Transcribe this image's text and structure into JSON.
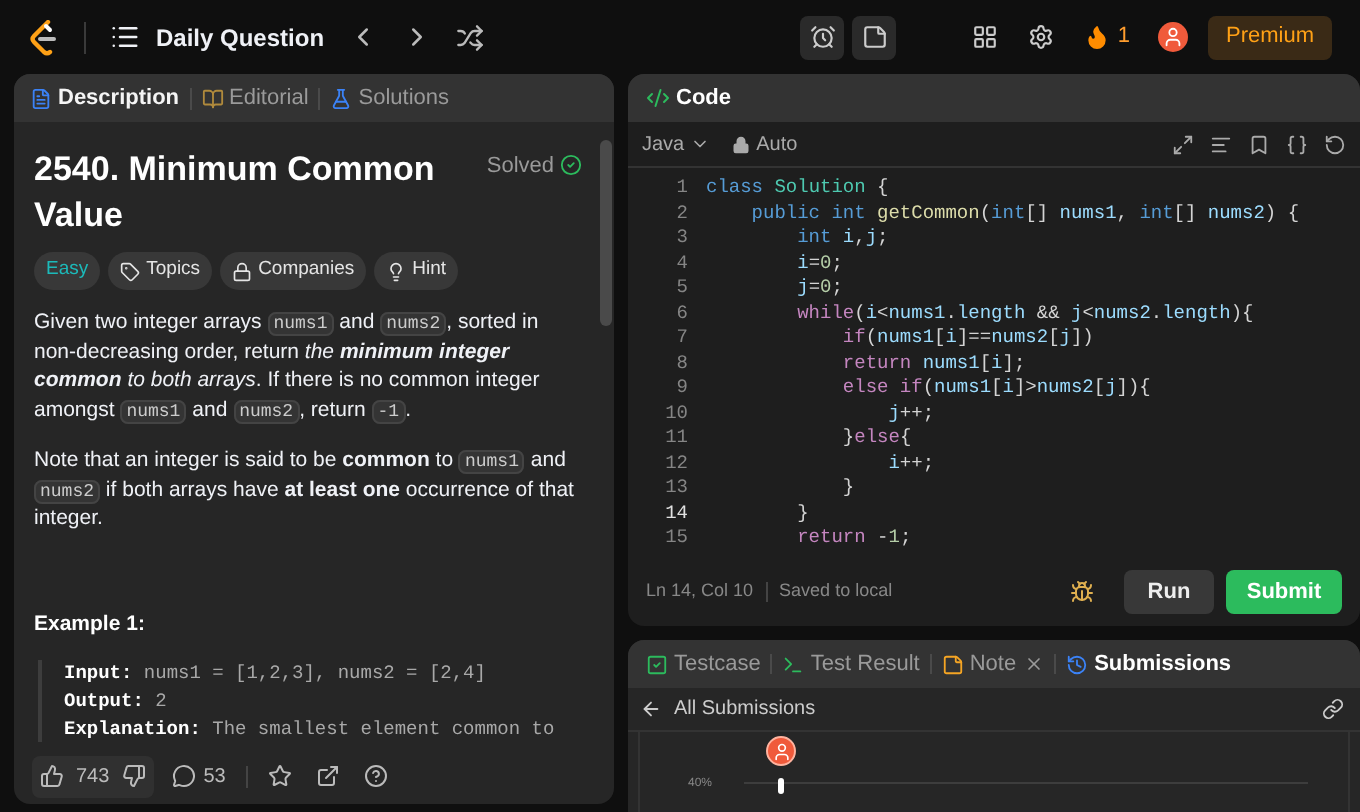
{
  "top_bar": {
    "title": "Daily Question",
    "streak": "1",
    "premium": "Premium"
  },
  "problem_panel": {
    "tabs": [
      {
        "label": "Description",
        "selected": true
      },
      {
        "label": "Editorial",
        "selected": false
      },
      {
        "label": "Solutions",
        "selected": false
      }
    ],
    "title": "2540. Minimum Common Value",
    "status": "Solved",
    "tags": [
      {
        "label": "Easy",
        "kind": "difficulty"
      },
      {
        "label": "Topics",
        "kind": "topics"
      },
      {
        "label": "Companies",
        "kind": "companies"
      },
      {
        "label": "Hint",
        "kind": "hint"
      }
    ],
    "paragraphs": [
      [
        {
          "kind": "text",
          "text": "Given two integer arrays "
        },
        {
          "kind": "code",
          "text": "nums1"
        },
        {
          "kind": "text",
          "text": " and "
        },
        {
          "kind": "code",
          "text": "nums2"
        },
        {
          "kind": "text",
          "text": ", sorted in non-decreasing order, return *the* "
        },
        {
          "kind": "strong_italic",
          "text": "minimum integer common"
        },
        {
          "kind": "text",
          "text": " *to both arrays*. If there is no common integer amongst "
        },
        {
          "kind": "code",
          "text": "nums1"
        },
        {
          "kind": "text",
          "text": " and "
        },
        {
          "kind": "code",
          "text": "nums2"
        },
        {
          "kind": "text",
          "text": ", return "
        },
        {
          "kind": "code",
          "text": "-1"
        },
        {
          "kind": "text",
          "text": "."
        }
      ],
      [
        {
          "kind": "text",
          "text": "Note that an integer is said to be **common** to "
        },
        {
          "kind": "code",
          "text": "nums1"
        },
        {
          "kind": "text",
          "text": " and "
        },
        {
          "kind": "code",
          "text": "nums2"
        },
        {
          "kind": "text",
          "text": " if both arrays have **at least one** occurrence of that integer."
        }
      ]
    ],
    "example": {
      "heading": "Example 1:",
      "lines": [
        {
          "label": "Input:",
          "value": "nums1 = [1,2,3], nums2 = [2,4]"
        },
        {
          "label": "Output:",
          "value": "2"
        },
        {
          "label": "Explanation:",
          "value": "The smallest element common to"
        }
      ]
    },
    "footer": {
      "likes": "743",
      "comments": "53"
    }
  },
  "code_panel": {
    "title": "Code",
    "language": "Java",
    "mode": "Auto",
    "lines": [
      {
        "number": "1",
        "current": false,
        "tokens": [
          {
            "text": "class",
            "kind": "kw"
          },
          {
            "text": " Solution",
            "kind": "cls"
          },
          {
            "text": " {"
          }
        ]
      },
      {
        "number": "2",
        "current": false,
        "tokens": [
          {
            "text": "    public int",
            "kind": "kw"
          },
          {
            "text": " getCommon",
            "kind": "fn"
          },
          {
            "text": "("
          },
          {
            "text": "int",
            "kind": "kw"
          },
          {
            "text": "[] "
          },
          {
            "text": "nums1",
            "kind": "var"
          },
          {
            "text": ", "
          },
          {
            "text": "int",
            "kind": "kw"
          },
          {
            "text": "[] "
          },
          {
            "text": "nums2",
            "kind": "var"
          },
          {
            "text": ") {"
          }
        ]
      },
      {
        "number": "3",
        "current": false,
        "tokens": [
          {
            "text": "        int",
            "kind": "kw"
          },
          {
            "text": " i",
            "kind": "var"
          },
          {
            "text": ","
          },
          {
            "text": "j",
            "kind": "var"
          },
          {
            "text": ";"
          }
        ]
      },
      {
        "number": "4",
        "current": false,
        "tokens": [
          {
            "text": "        i",
            "kind": "var"
          },
          {
            "text": "="
          },
          {
            "text": "0",
            "kind": "num"
          },
          {
            "text": ";"
          }
        ]
      },
      {
        "number": "5",
        "current": false,
        "tokens": [
          {
            "text": "        j",
            "kind": "var"
          },
          {
            "text": "="
          },
          {
            "text": "0",
            "kind": "num"
          },
          {
            "text": ";"
          }
        ]
      },
      {
        "number": "6",
        "current": false,
        "tokens": [
          {
            "text": "        while",
            "kind": "ctl"
          },
          {
            "text": "("
          },
          {
            "text": "i",
            "kind": "var"
          },
          {
            "text": "<"
          },
          {
            "text": "nums1",
            "kind": "var"
          },
          {
            "text": "."
          },
          {
            "text": "length",
            "kind": "var"
          },
          {
            "text": " && "
          },
          {
            "text": "j",
            "kind": "var"
          },
          {
            "text": "<"
          },
          {
            "text": "nums2",
            "kind": "var"
          },
          {
            "text": "."
          },
          {
            "text": "length",
            "kind": "var"
          },
          {
            "text": "){"
          }
        ]
      },
      {
        "number": "7",
        "current": false,
        "tokens": [
          {
            "text": "            if",
            "kind": "ctl"
          },
          {
            "text": "("
          },
          {
            "text": "nums1",
            "kind": "var"
          },
          {
            "text": "["
          },
          {
            "text": "i",
            "kind": "var"
          },
          {
            "text": "]=="
          },
          {
            "text": "nums2",
            "kind": "var"
          },
          {
            "text": "["
          },
          {
            "text": "j",
            "kind": "var"
          },
          {
            "text": "])"
          }
        ]
      },
      {
        "number": "8",
        "current": false,
        "tokens": [
          {
            "text": "            return",
            "kind": "ctl"
          },
          {
            "text": " nums1",
            "kind": "var"
          },
          {
            "text": "["
          },
          {
            "text": "i",
            "kind": "var"
          },
          {
            "text": "];"
          }
        ]
      },
      {
        "number": "9",
        "current": false,
        "tokens": [
          {
            "text": "            else if",
            "kind": "ctl"
          },
          {
            "text": "("
          },
          {
            "text": "nums1",
            "kind": "var"
          },
          {
            "text": "["
          },
          {
            "text": "i",
            "kind": "var"
          },
          {
            "text": "]>"
          },
          {
            "text": "nums2",
            "kind": "var"
          },
          {
            "text": "["
          },
          {
            "text": "j",
            "kind": "var"
          },
          {
            "text": "]){"
          }
        ]
      },
      {
        "number": "10",
        "current": false,
        "tokens": [
          {
            "text": "                j",
            "kind": "var"
          },
          {
            "text": "++;"
          }
        ]
      },
      {
        "number": "11",
        "current": false,
        "tokens": [
          {
            "text": "            }"
          },
          {
            "text": "else",
            "kind": "ctl"
          },
          {
            "text": "{"
          }
        ]
      },
      {
        "number": "12",
        "current": false,
        "tokens": [
          {
            "text": "                i",
            "kind": "var"
          },
          {
            "text": "++;"
          }
        ]
      },
      {
        "number": "13",
        "current": false,
        "tokens": [
          {
            "text": "            }"
          }
        ]
      },
      {
        "number": "14",
        "current": true,
        "tokens": [
          {
            "text": "        }"
          }
        ]
      },
      {
        "number": "15",
        "current": false,
        "tokens": [
          {
            "text": "        return",
            "kind": "ctl"
          },
          {
            "text": " -"
          },
          {
            "text": "1",
            "kind": "num"
          },
          {
            "text": ";"
          }
        ]
      }
    ],
    "status": "Ln 14, Col 10",
    "saved": "Saved to local",
    "run": "Run",
    "submit": "Submit"
  },
  "result_panel": {
    "tabs": [
      {
        "label": "Testcase",
        "selected": false,
        "kind": "testcase"
      },
      {
        "label": "Test Result",
        "selected": false,
        "kind": "result"
      },
      {
        "label": "Note",
        "selected": false,
        "kind": "note"
      },
      {
        "label": "Submissions",
        "selected": true,
        "kind": "submissions"
      }
    ],
    "back_label": "All Submissions",
    "axis_label": "40%"
  }
}
